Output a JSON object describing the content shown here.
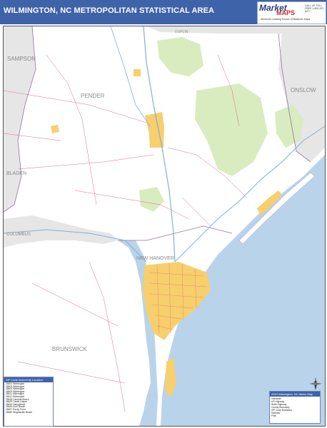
{
  "title": "WILMINGTON, NC METROPOLITAN STATISTICAL AREA",
  "logo": {
    "brand": "Market",
    "brand2": "MAPS",
    "tagline": "America's Leading Source of Business Maps",
    "phone": "CALL US TOLL FREE 1-800-337-6277"
  },
  "map": {
    "county_labels": [
      "SAMPSON",
      "PENDER",
      "ONSLOW",
      "BLADEN",
      "COLUMBUS",
      "NEW HANOVER",
      "BRUNSWICK",
      "DUPLIN"
    ],
    "colors": {
      "ocean": "#b9d3ea",
      "land": "#ffffff",
      "outside_county": "#e6e6e6",
      "urban": "#f7cf6c",
      "park": "#d8ecc0",
      "water_inland": "#b9d3ea",
      "roads": "#e06a8a",
      "highways": "#7fb0d9",
      "county_border": "#9b6fa7"
    }
  },
  "legend_zip": {
    "heading": "ZIP Code Index/City Location",
    "rows": [
      "28401 Wilmington",
      "28403 Wilmington",
      "28405 Wilmington",
      "28409 Wilmington",
      "28411 Wilmington",
      "28412 Wilmington",
      "28428 Carolina Beach",
      "28429 Castle Hayne",
      "28443 Hampstead",
      "28449 Kure Beach",
      "28457 Rocky Point",
      "28480 Wrightsville Beach"
    ]
  },
  "legend_key": {
    "heading": "2010 Wilmington, NC Metro Map",
    "rows": [
      "Interstate",
      "US Highway",
      "State Highway",
      "County Boundary",
      "ZIP Code Boundary",
      "Railroad",
      "Park"
    ]
  },
  "compass_label": "N"
}
